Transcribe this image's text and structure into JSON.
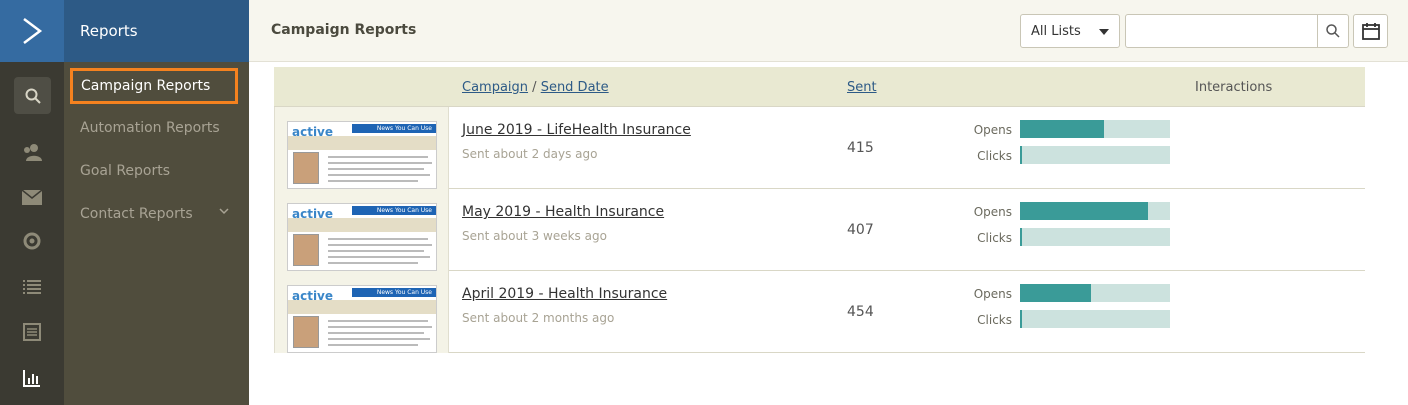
{
  "nav": {
    "section_title": "Reports",
    "items": [
      {
        "label": "Campaign Reports",
        "active": true
      },
      {
        "label": "Automation Reports",
        "active": false
      },
      {
        "label": "Goal Reports",
        "active": false
      },
      {
        "label": "Contact Reports",
        "active": false
      }
    ],
    "rail_icons": [
      "search-icon",
      "contacts-icon",
      "mail-icon",
      "automation-icon",
      "lists-icon",
      "forms-icon",
      "reports-icon"
    ]
  },
  "header": {
    "title": "Campaign Reports",
    "list_filter": "All Lists",
    "search_placeholder": ""
  },
  "table": {
    "col_campaign": "Campaign",
    "col_separator": " / ",
    "col_send_date": "Send Date",
    "col_sent": "Sent",
    "col_interactions": "Interactions",
    "opens_label": "Opens",
    "clicks_label": "Clicks",
    "rows": [
      {
        "title": "June 2019 - LifeHealth Insurance",
        "sent_ago": "Sent about 2 days ago",
        "sent": "415",
        "opens": 0.56,
        "clicks": 0.01
      },
      {
        "title": "May 2019 - Health Insurance",
        "sent_ago": "Sent about 3 weeks ago",
        "sent": "407",
        "opens": 0.85,
        "clicks": 0.01
      },
      {
        "title": "April 2019 - Health Insurance",
        "sent_ago": "Sent about 2 months ago",
        "sent": "454",
        "opens": 0.47,
        "clicks": 0.01
      }
    ]
  },
  "thumbnail": {
    "logo_text": "active",
    "banner_text": "News You Can Use"
  },
  "colors": {
    "accent_orange": "#f5821f",
    "brand_blue": "#2d5a86",
    "bar_fill": "#3a9b98",
    "bar_track": "#cce2de"
  }
}
